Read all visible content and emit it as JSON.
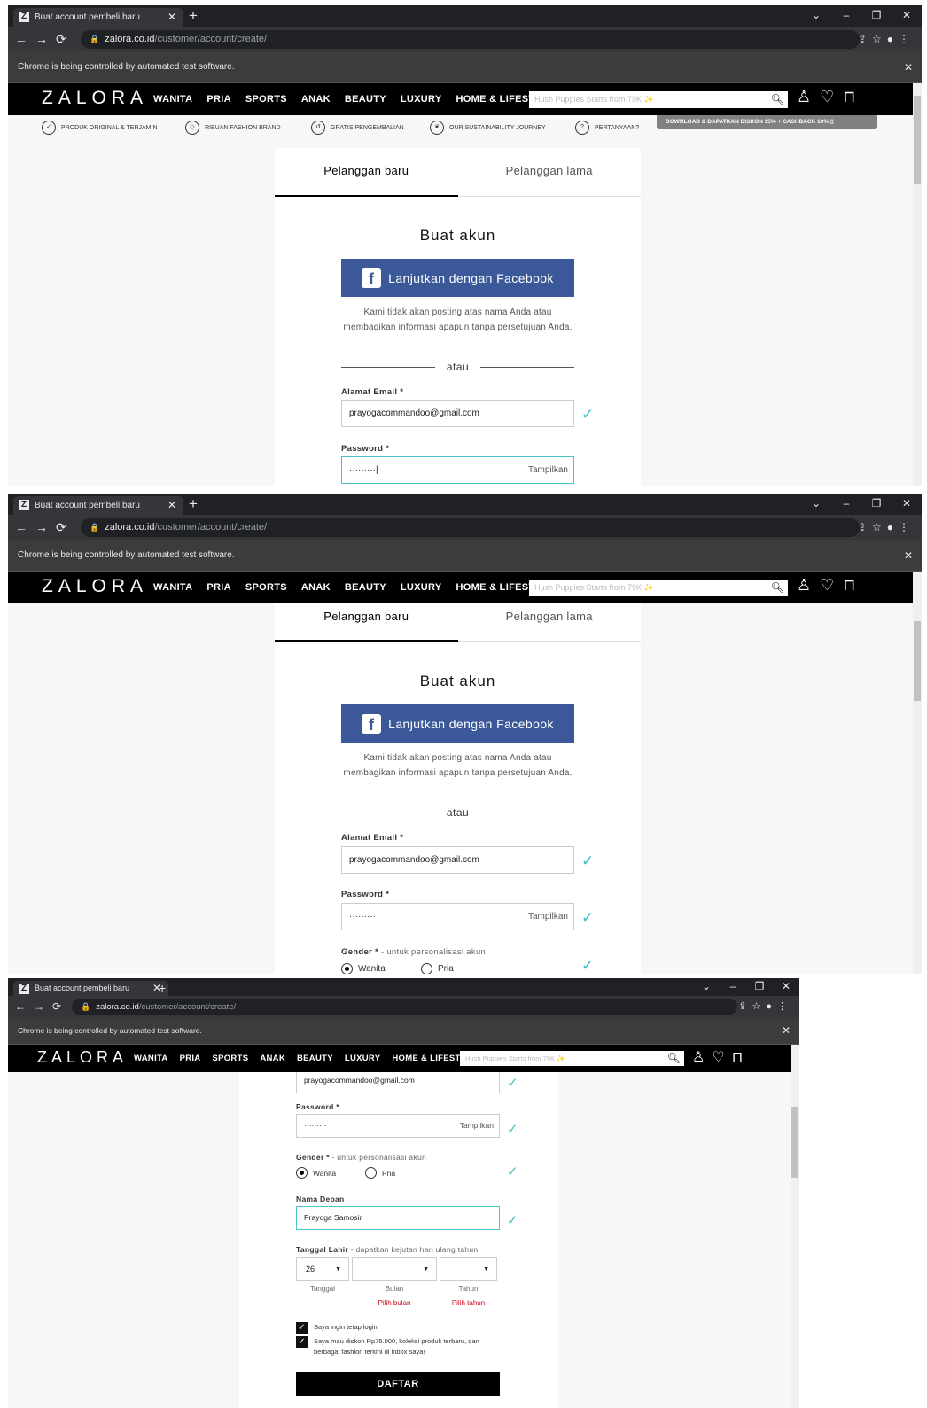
{
  "browser": {
    "tab_title": "Buat account pembeli baru",
    "tab_favicon": "Z",
    "new_tab": "+",
    "url_host": "zalora.co.id",
    "url_path": "/customer/account/create/",
    "infobar_text": "Chrome is being controlled by automated test software."
  },
  "site": {
    "logo": "ZALORA",
    "nav": [
      "WANITA",
      "PRIA",
      "SPORTS",
      "ANAK",
      "BEAUTY",
      "LUXURY",
      "HOME & LIFESTYLE"
    ],
    "search_placeholder": "Hush Puppies Starts from 79K ✨"
  },
  "perks": {
    "items": [
      "PRODUK ORIGINAL & TERJAMIN",
      "RIBUAN FASHION BRAND",
      "GRATIS PENGEMBALIAN",
      "OUR SUSTAINABILITY JOURNEY",
      "PERTANYAAN?"
    ],
    "download": "DOWNLOAD & DAPATKAN DISKON 15% + CASHBACK 10%"
  },
  "form": {
    "tab_new": "Pelanggan baru",
    "tab_existing": "Pelanggan lama",
    "title": "Buat akun",
    "facebook_button": "Lanjutkan dengan Facebook",
    "facebook_note": "Kami tidak akan posting atas nama Anda atau membagikan informasi apapun tanpa persetujuan Anda.",
    "divider": "atau",
    "email_label": "Alamat Email *",
    "email_value": "prayogacommandoo@gmail.com",
    "password_label": "Password *",
    "password_value": "·········",
    "password_show": "Tampilkan",
    "gender_label": "Gender *",
    "gender_hint": " - untuk personalisasi akun",
    "gender_female": "Wanita",
    "gender_male": "Pria",
    "first_name_label": "Nama Depan",
    "first_name_value": "Prayoga Samosir",
    "dob_label": "Tanggal Lahir",
    "dob_hint": " - dapatkan kejutan hari ulang tahun!",
    "dob_day_value": "26",
    "dob_day_label": "Tanggal",
    "dob_month_label": "Bulan",
    "dob_year_label": "Tahun",
    "dob_month_error": "Pilih bulan",
    "dob_year_error": "Pilih tahun",
    "keep_login": "Saya ingin tetap login",
    "newsletter": "Saya mau diskon Rp75.000, koleksi produk terbaru, dan berbagai fashion terkini di inbox saya!",
    "submit": "DAFTAR"
  }
}
